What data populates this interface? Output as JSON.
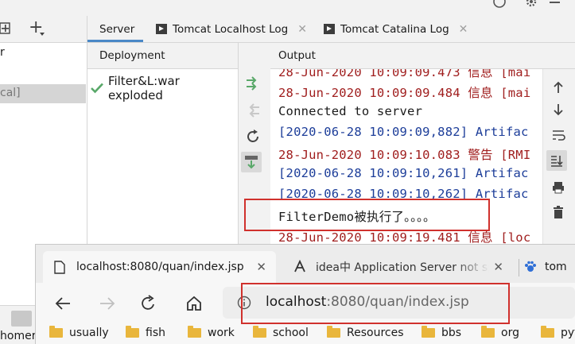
{
  "ide": {
    "left_panel": {
      "item_partial_1": "r",
      "item_partial_2": "cal]",
      "add_glyph": "+",
      "bottom_partial": "homer"
    },
    "tabs": [
      {
        "label": "Server"
      },
      {
        "label": "Tomcat Localhost Log"
      },
      {
        "label": "Tomcat Catalina Log"
      }
    ],
    "deployment": {
      "header": "Deployment",
      "items": [
        {
          "label": "Filter&L:war exploded"
        }
      ]
    },
    "output": {
      "header": "Output",
      "lines": [
        {
          "text": "28-Jun-2020 10:09:09.473 信息 [mai",
          "kind": "red"
        },
        {
          "text": "28-Jun-2020 10:09:09.484 信息 [mai",
          "kind": "red"
        },
        {
          "text": "Connected to server",
          "kind": "black"
        },
        {
          "text": "[2020-06-28 10:09:09,882] Artifac",
          "kind": "blue"
        },
        {
          "text": "28-Jun-2020 10:09:10.083 警告 [RMI",
          "kind": "red"
        },
        {
          "text": "[2020-06-28 10:09:10,261] Artifac",
          "kind": "blue"
        },
        {
          "text": "[2020-06-28 10:09:10,262] Artifac",
          "kind": "blue"
        },
        {
          "text": "FilterDemo被执行了。。。。",
          "kind": "black"
        },
        {
          "text": "28-Jun-2020 10:09:19.481 信息 [loc",
          "kind": "red"
        }
      ]
    },
    "colors": {
      "red": "#a01e1e",
      "blue": "#1c3d99",
      "highlight": "#d0312d",
      "tab_underline": "#4a88c7"
    }
  },
  "browser": {
    "tabs": [
      {
        "title": "localhost:8080/quan/index.jsp"
      },
      {
        "title": "idea中 Application Server not sp"
      },
      {
        "title": "tom"
      }
    ],
    "address": {
      "host": "localhost",
      "path": ":8080/quan/index.jsp"
    },
    "bookmarks": [
      {
        "label": "usually"
      },
      {
        "label": "fish"
      },
      {
        "label": "work"
      },
      {
        "label": "school"
      },
      {
        "label": "Resources"
      },
      {
        "label": "bbs"
      },
      {
        "label": "org"
      },
      {
        "label": "pyt"
      }
    ]
  }
}
